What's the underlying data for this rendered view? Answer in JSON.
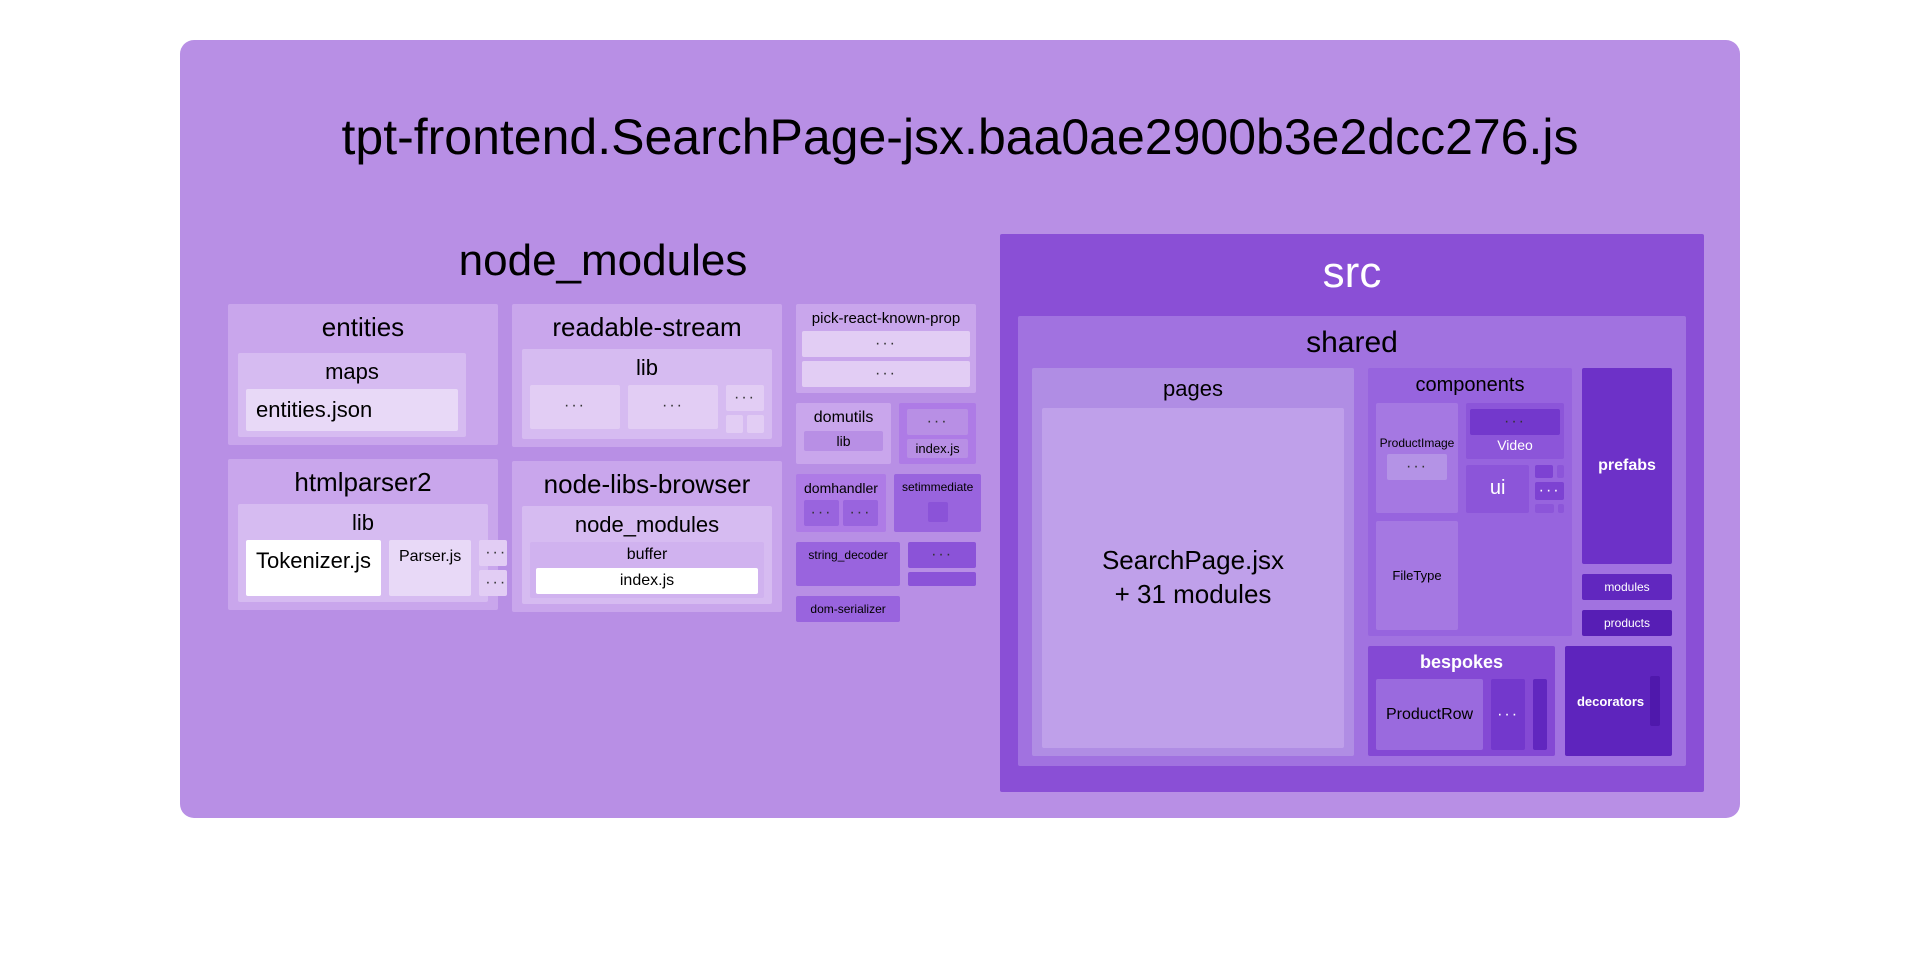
{
  "title": "tpt-frontend.SearchPage-jsx.baa0ae2900b3e2dcc276.js",
  "ellipsis": "···",
  "node_modules": {
    "title": "node_modules",
    "entities": {
      "title": "entities",
      "maps": "maps",
      "file": "entities.json"
    },
    "htmlparser2": {
      "title": "htmlparser2",
      "lib": "lib",
      "tokenizer": "Tokenizer.js",
      "parser": "Parser.js"
    },
    "readable_stream": {
      "title": "readable-stream",
      "lib": "lib"
    },
    "node_libs_browser": {
      "title": "node-libs-browser",
      "node_modules": "node_modules",
      "buffer": "buffer",
      "index": "index.js"
    },
    "col3": {
      "pick": "pick-react-known-prop",
      "domutils": "domutils",
      "domutils_lib": "lib",
      "index": "index.js",
      "domhandler": "domhandler",
      "setimmediate": "setimmediate",
      "string_decoder": "string_decoder",
      "dom_serializer": "dom-serializer"
    }
  },
  "src": {
    "title": "src",
    "shared": {
      "title": "shared",
      "pages": {
        "title": "pages",
        "main": "SearchPage.jsx\n+ 31 modules"
      },
      "components": {
        "title": "components",
        "product_image": "ProductImage",
        "video": "Video",
        "file_type": "FileType",
        "ui": "ui"
      },
      "prefabs": "prefabs",
      "modules": "modules",
      "products": "products",
      "bespokes": {
        "title": "bespokes",
        "product_row": "ProductRow"
      },
      "decorators": "decorators"
    }
  }
}
